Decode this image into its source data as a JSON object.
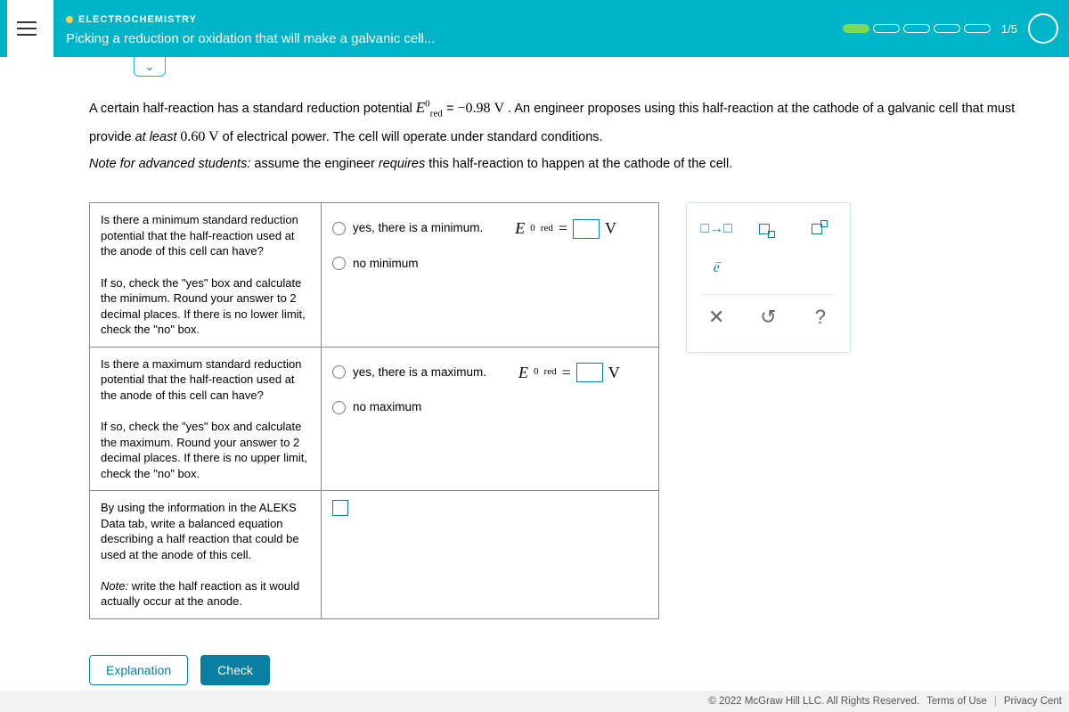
{
  "header": {
    "topic": "ELECTROCHEMISTRY",
    "lesson": "Picking a reduction or oxidation that will make a galvanic cell...",
    "progress_label": "1/5"
  },
  "prompt": {
    "pre": "A certain half-reaction has a standard reduction potential ",
    "e_symbol": "E",
    "e_sup": "0",
    "e_sub": "red",
    "eq": " = ",
    "value": "−0.98",
    "unit": " V",
    "post1": ". An engineer proposes using this half-reaction at the cathode of a galvanic cell that must provide ",
    "atleast": "at least",
    "power_val": " 0.60 V",
    "post2": " of electrical power. The cell will operate under standard conditions.",
    "note_label": "Note for advanced students:",
    "note_rest": " assume the engineer ",
    "requires": "requires",
    "note_tail": " this half-reaction to happen at the cathode of the cell."
  },
  "rows": {
    "r1": {
      "q1": "Is there a minimum standard reduction potential that the half-reaction used at the anode of this cell can have?",
      "q2": "If so, check the \"yes\" box and calculate the minimum. Round your answer to 2 decimal places. If there is no lower limit, check the \"no\" box.",
      "opt_yes": "yes, there is a minimum.",
      "opt_no": "no minimum",
      "unit": "V"
    },
    "r2": {
      "q1": "Is there a maximum standard reduction potential that the half-reaction used at the anode of this cell can have?",
      "q2": "If so, check the \"yes\" box and calculate the maximum. Round your answer to 2 decimal places. If there is no upper limit, check the \"no\" box.",
      "opt_yes": "yes, there is a maximum.",
      "opt_no": "no maximum",
      "unit": "V"
    },
    "r3": {
      "q1": "By using the information in the ALEKS Data tab, write a balanced equation describing a half reaction that could be used at the anode of this cell.",
      "q2_pre": "Note:",
      "q2_rest": " write the half reaction as it would actually occur at the anode."
    }
  },
  "palette": {
    "arrow": "□→□",
    "sub_tool": "□",
    "sup_tool": "□",
    "e_tool": "e",
    "clear": "✕",
    "reset": "↺",
    "help": "?"
  },
  "buttons": {
    "explain": "Explanation",
    "check": "Check"
  },
  "footer": {
    "copyright": "© 2022 McGraw Hill LLC. All Rights Reserved.",
    "terms": "Terms of Use",
    "privacy": "Privacy Cent"
  },
  "labels": {
    "ered_E": "E",
    "ered_sup": "0",
    "ered_sub": "red",
    "eq": "="
  }
}
